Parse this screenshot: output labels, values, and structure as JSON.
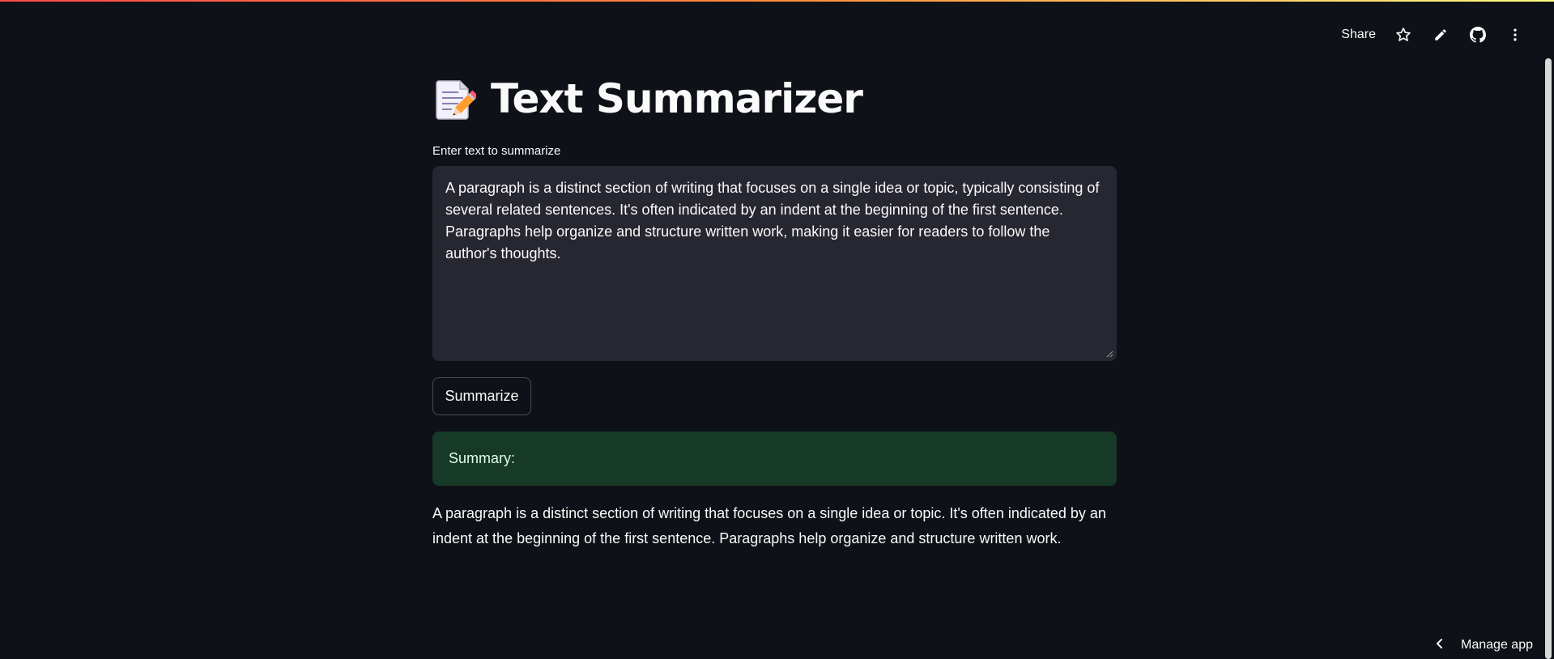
{
  "header": {
    "share_label": "Share",
    "icons": [
      "star-icon",
      "pencil-icon",
      "github-icon",
      "more-vertical-icon"
    ]
  },
  "title": {
    "emoji_icon": "memo-icon",
    "text": "Text Summarizer"
  },
  "input": {
    "label": "Enter text to summarize",
    "value": "A paragraph is a distinct section of writing that focuses on a single idea or topic, typically consisting of several related sentences. It's often indicated by an indent at the beginning of the first sentence. Paragraphs help organize and structure written work, making it easier for readers to follow the author's thoughts."
  },
  "button": {
    "label": "Summarize"
  },
  "result": {
    "success_label": "Summary:",
    "summary_text": "A paragraph is a distinct section of writing that focuses on a single idea or topic. It's often indicated by an indent at the beginning of the first sentence. Paragraphs help organize and structure written work."
  },
  "footer": {
    "manage_app_label": "Manage app",
    "manage_icon": "chevron-left-icon"
  },
  "colors": {
    "background": "#0e1117",
    "textarea_bg": "#262730",
    "success_bg": "#173928",
    "accent": "#ff4b4b"
  }
}
